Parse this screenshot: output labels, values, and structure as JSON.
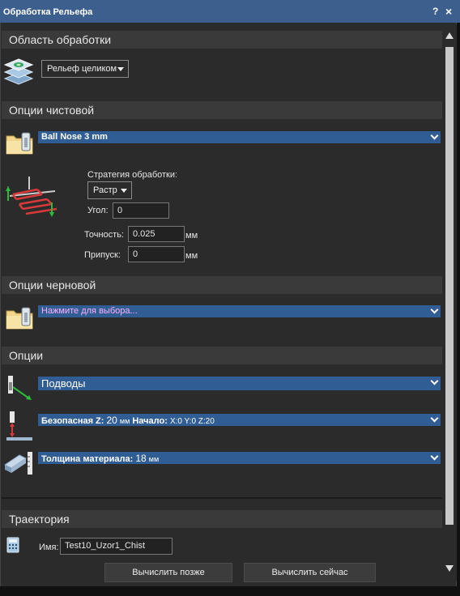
{
  "window": {
    "title": "Обработка Рельефа",
    "help": "?",
    "close": "×"
  },
  "area": {
    "header": "Область обработки",
    "dropdown": "Рельеф целиком"
  },
  "finish": {
    "header": "Опции чистовой",
    "tool": "Ball Nose 3 mm",
    "strategy_label": "Стратегия обработки:",
    "strategy_value": "Растр",
    "angle_label": "Угол:",
    "angle_value": "0",
    "tolerance_label": "Точность:",
    "tolerance_value": "0.025",
    "tolerance_unit": "мм",
    "allowance_label": "Припуск:",
    "allowance_value": "0",
    "allowance_unit": "мм"
  },
  "rough": {
    "header": "Опции черновой",
    "tool": "Нажмите для выбора..."
  },
  "options": {
    "header": "Опции",
    "leadins": "Подводы",
    "safez_label": "Безопасная Z:",
    "safez_value": "20",
    "safez_unit": "мм",
    "home_label": "Начало",
    "home_value": "X:0 Y:0 Z:20",
    "thickness_label": "Толщина материала:",
    "thickness_value": "18",
    "thickness_unit": "мм"
  },
  "toolpath": {
    "header": "Траектория",
    "name_label": "Имя:",
    "name_value": "Test10_Uzor1_Chist"
  },
  "buttons": {
    "later": "Вычислить позже",
    "now": "Вычислить сейчас"
  },
  "colors": {
    "titlebar": "#3c5f8e",
    "panel": "#2b2b2b",
    "header": "#3a3a3a",
    "selection": "#2f5d94",
    "accent_text": "#ffb0ff"
  }
}
